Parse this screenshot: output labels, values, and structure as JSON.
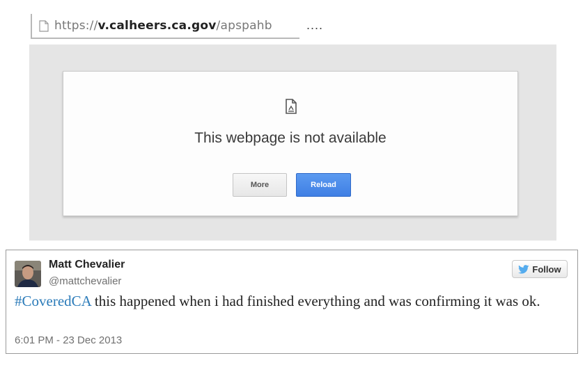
{
  "browser": {
    "url_scheme": "https://",
    "url_host": "v.calheers.ca.gov",
    "url_path": "/apspahb",
    "ellipsis": "....",
    "error_title": "This webpage is not available",
    "more_label": "More",
    "reload_label": "Reload",
    "reload_color": "#4285f4"
  },
  "tweet": {
    "author_name": "Matt Chevalier",
    "author_handle": "@mattchevalier",
    "follow_label": "Follow",
    "hashtag": "#CoveredCA",
    "text": " this happened when i had finished everything and was confirming it was ok.",
    "timestamp": "6:01 PM - 23 Dec 2013",
    "hashtag_color": "#2b7bb9"
  }
}
